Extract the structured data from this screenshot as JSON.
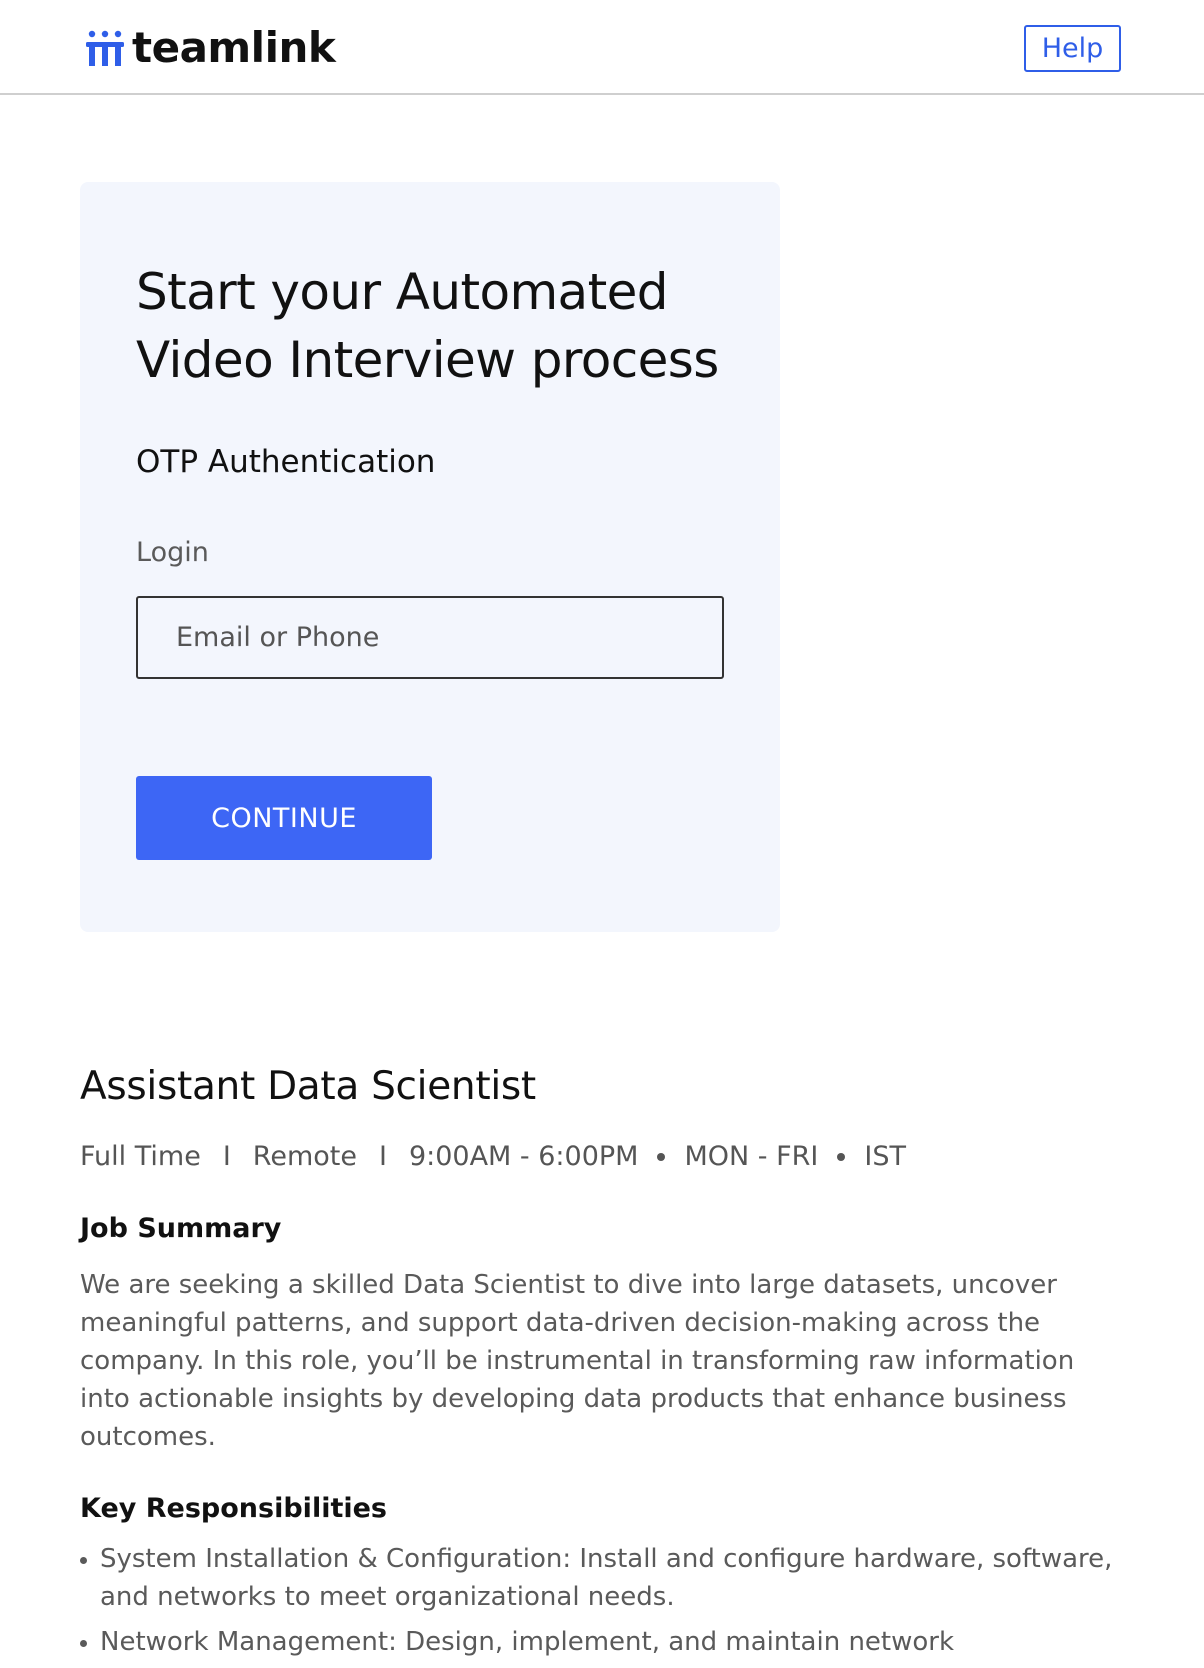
{
  "header": {
    "logo_text": "teamlink",
    "help_label": "Help"
  },
  "login_card": {
    "title": "Start your Automated Video Interview process",
    "subtitle": "OTP Authentication",
    "login_label": "Login",
    "input_placeholder": "Email or Phone",
    "input_value": "",
    "continue_label": "CONTINUE"
  },
  "job": {
    "title": "Assistant Data Scientist",
    "meta": {
      "type": "Full Time",
      "location": "Remote",
      "hours": "9:00AM - 6:00PM",
      "days": "MON - FRI",
      "timezone": "IST",
      "separator": "I"
    },
    "summary_heading": "Job Summary",
    "summary_text": "We are seeking a skilled Data Scientist to dive into large datasets, uncover meaningful patterns, and support data-driven decision-making across the company. In this role, you’ll be instrumental in transforming raw information into actionable insights by developing data products that enhance business outcomes.",
    "responsibilities_heading": "Key Responsibilities",
    "responsibilities": [
      "System Installation & Configuration: Install and configure hardware, software, and networks to meet organizational needs.",
      "Network Management: Design, implement, and maintain network"
    ]
  },
  "colors": {
    "brand_blue": "#2f5ee8",
    "button_blue": "#3d66f5",
    "card_background": "#f3f6fd"
  }
}
